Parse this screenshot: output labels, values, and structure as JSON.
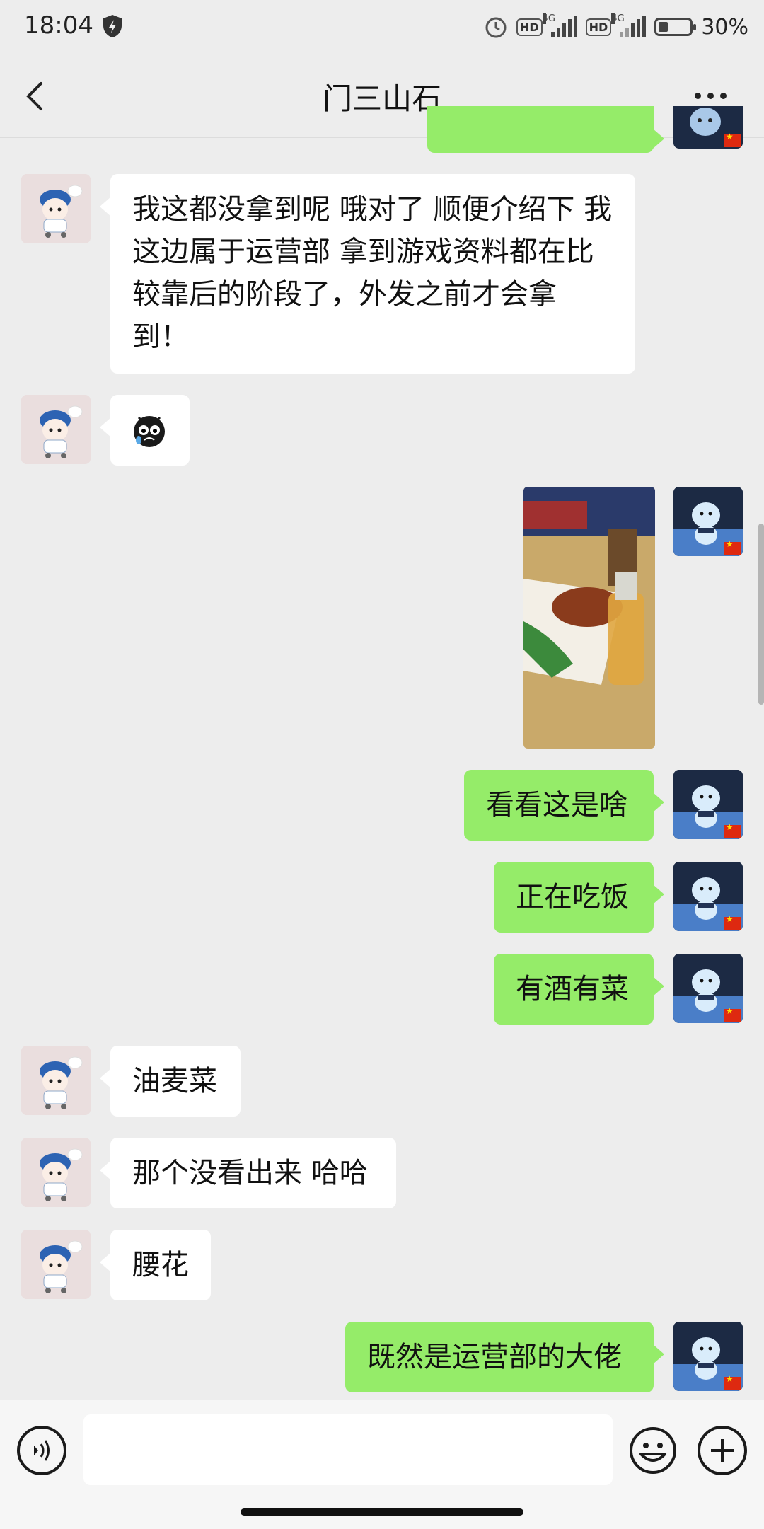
{
  "status_bar": {
    "time": "18:04",
    "hd1": "HD",
    "net1": "4G",
    "hd2": "HD",
    "net2": "4G",
    "battery_level": 0.3,
    "battery_text": "30%",
    "icons": [
      "shield-icon",
      "alarm-icon",
      "signal-icon",
      "battery-icon"
    ]
  },
  "header": {
    "title": "门三山石",
    "back_icon": "chevron-left-icon",
    "more_icon": "more-dots-icon"
  },
  "messages": [
    {
      "side": "left",
      "type": "text",
      "text": "我这都没拿到呢 哦对了 顺便介绍下 我\n这边属于运营部 拿到游戏资料都在比\n较靠后的阶段了，外发之前才会拿\n到！"
    },
    {
      "side": "left",
      "type": "emoji",
      "emoji": "crying-face-icon"
    },
    {
      "side": "right",
      "type": "image",
      "description_icon": "photo-icon"
    },
    {
      "side": "right",
      "type": "text",
      "text": "看看这是啥"
    },
    {
      "side": "right",
      "type": "text",
      "text": "正在吃饭"
    },
    {
      "side": "right",
      "type": "text",
      "text": "有酒有菜"
    },
    {
      "side": "left",
      "type": "text",
      "text": "油麦菜"
    },
    {
      "side": "left",
      "type": "text",
      "text": "那个没看出来 哈哈"
    },
    {
      "side": "left",
      "type": "text",
      "text": "腰花"
    },
    {
      "side": "right",
      "type": "text",
      "text": "既然是运营部的大佬"
    }
  ],
  "input_bar": {
    "voice_icon": "voice-icon",
    "emoji_icon": "emoji-icon",
    "plus_icon": "plus-icon",
    "placeholder": ""
  },
  "colors": {
    "background": "#ededed",
    "bubble_right": "#95ec69",
    "bubble_left": "#ffffff"
  }
}
